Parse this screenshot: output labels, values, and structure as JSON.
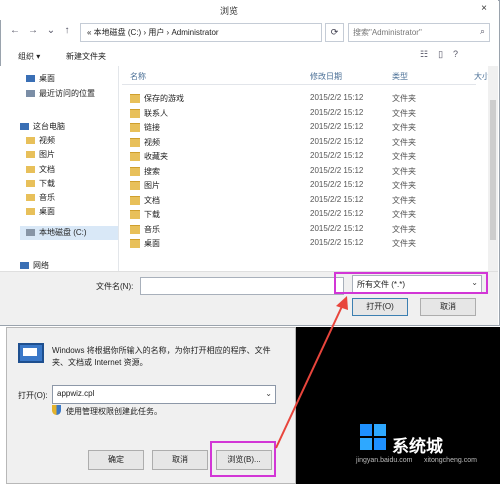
{
  "browse_dialog": {
    "title": "浏览",
    "window_controls": {
      "close": "×"
    },
    "address": "« 本地磁盘 (C:) › 用户 › Administrator",
    "search_placeholder": "搜索\"Administrator\"",
    "toolbar": {
      "organize": "组织 ▾",
      "new_folder": "新建文件夹"
    },
    "nav_items": [
      {
        "label": "桌面",
        "icon_color": "#3a6fb5"
      },
      {
        "label": "最近访问的位置",
        "icon_color": "#7b8ea6"
      },
      {
        "label": "这台电脑",
        "icon_color": "#3a6fb5"
      },
      {
        "label": "视频",
        "icon_color": "#e8c05a"
      },
      {
        "label": "图片",
        "icon_color": "#e8c05a"
      },
      {
        "label": "文档",
        "icon_color": "#e8c05a"
      },
      {
        "label": "下载",
        "icon_color": "#e8c05a"
      },
      {
        "label": "音乐",
        "icon_color": "#e8c05a"
      },
      {
        "label": "桌面",
        "icon_color": "#e8c05a"
      },
      {
        "label": "本地磁盘 (C:)",
        "icon_color": "#8795a6"
      },
      {
        "label": "网络",
        "icon_color": "#3a6fb5"
      }
    ],
    "columns": {
      "name": "名称",
      "date": "修改日期",
      "type": "类型",
      "size": "大小"
    },
    "files": [
      {
        "name": "保存的游戏",
        "date": "2015/2/2 15:12",
        "type": "文件夹"
      },
      {
        "name": "联系人",
        "date": "2015/2/2 15:12",
        "type": "文件夹"
      },
      {
        "name": "链接",
        "date": "2015/2/2 15:12",
        "type": "文件夹"
      },
      {
        "name": "视频",
        "date": "2015/2/2 15:12",
        "type": "文件夹"
      },
      {
        "name": "收藏夹",
        "date": "2015/2/2 15:12",
        "type": "文件夹"
      },
      {
        "name": "搜索",
        "date": "2015/2/2 15:12",
        "type": "文件夹"
      },
      {
        "name": "图片",
        "date": "2015/2/2 15:12",
        "type": "文件夹"
      },
      {
        "name": "文档",
        "date": "2015/2/2 15:12",
        "type": "文件夹"
      },
      {
        "name": "下载",
        "date": "2015/2/2 15:12",
        "type": "文件夹"
      },
      {
        "name": "音乐",
        "date": "2015/2/2 15:12",
        "type": "文件夹"
      },
      {
        "name": "桌面",
        "date": "2015/2/2 15:12",
        "type": "文件夹"
      }
    ],
    "filename_label": "文件名(N):",
    "filename_value": "",
    "filetype_value": "所有文件 (*.*)",
    "open_button": "打开(O)",
    "cancel_button": "取消"
  },
  "run_dialog": {
    "description": "Windows 将根据你所输入的名称，为你打开相应的程序、文件夹、文档或 Internet 资源。",
    "open_label": "打开(O):",
    "input_value": "appwiz.cpl",
    "admin_note": "使用管理权限创建此任务。",
    "ok_button": "确定",
    "cancel_button": "取消",
    "browse_button": "浏览(B)..."
  },
  "watermark": {
    "brand": "系统城",
    "sub1": "jingyan.baidu.com",
    "sub2": "xitongcheng.com"
  },
  "colors": {
    "highlight": "#d236d6",
    "arrow": "#e8453c",
    "selection": "#d9e8f7"
  }
}
